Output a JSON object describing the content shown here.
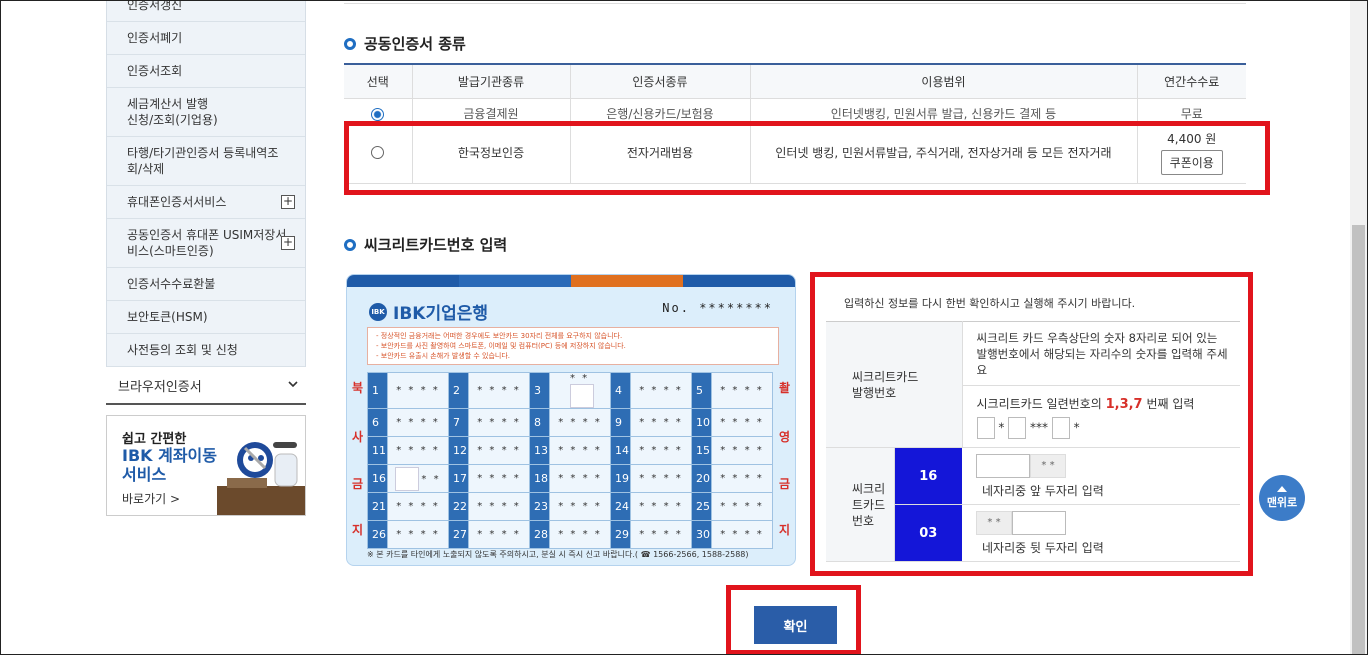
{
  "sidebar": {
    "items": [
      {
        "label": "인증서갱신"
      },
      {
        "label": "인증서폐기"
      },
      {
        "label": "인증서조회"
      },
      {
        "label": "세금계산서 발행\n신청/조회(기업용)"
      },
      {
        "label": "타행/타기관인증서 등록내역조\n회/삭제"
      },
      {
        "label": "휴대폰인증서서비스",
        "expand": "+"
      },
      {
        "label": "공동인증서 휴대폰 USIM저장서\n비스(스마트인증)",
        "expand": "+"
      },
      {
        "label": "인증서수수료환불"
      },
      {
        "label": "보안토큰(HSM)"
      },
      {
        "label": "사전등의 조회 및 신청"
      }
    ],
    "group_label": "브라우저인증서",
    "banner": {
      "line1": "쉽고 간편한",
      "line2": "IBK 계좌이동\n서비스",
      "link": "바로가기 >"
    }
  },
  "cert_section": {
    "title": "공동인증서 종류",
    "headers": [
      "선택",
      "발급기관종류",
      "인증서종류",
      "이용범위",
      "연간수수료"
    ],
    "rows": [
      {
        "org": "금융결제원",
        "type": "은행/신용카드/보험용",
        "scope": "인터넷뱅킹, 민원서류 발급, 신용카드 결제 등",
        "fee": "무료",
        "selected": true
      },
      {
        "org": "한국정보인증",
        "type": "전자거래범용",
        "scope": "인터넷 뱅킹, 민원서류발급, 주식거래, 전자상거래 등 모든 전자거래",
        "fee": "4,400 원",
        "coupon": "쿠폰이용",
        "selected": false
      }
    ]
  },
  "secret_section": {
    "title": "씨크리트카드번호 입력"
  },
  "card": {
    "bank": "IBK기업은행",
    "logo_mark": "IBK",
    "no_label": "No.",
    "no_value": "********",
    "notice": [
      "- 정상적인 금융거래는 어떠한 경우에도 보안카드 30자리 전체를 요구하지 않습니다.",
      "- 보안카드를 사진 촬영하여 스마트폰, 이메일 및 컴퓨터(PC) 등에 저장하지 않습니다.",
      "- 보안카드 유출시 손해가 발생할 수 있습니다."
    ],
    "left_chars": [
      "북",
      "사",
      "금",
      "지"
    ],
    "right_chars": [
      "촬",
      "영",
      "금",
      "지"
    ],
    "mask": "* * * *",
    "partial_mask_3": "* *",
    "partial_mask_16": "* *",
    "footer": "※ 본 카드를 타인에게 노출되지 않도록 주의하시고, 분실 시 즉시 신고 바랍니다.( ☎ 1566-2566, 1588-2588)",
    "stripe_colors": [
      "#1f5ba8",
      "#2a6ab8",
      "#e0701f",
      "#1f5ba8"
    ]
  },
  "panel": {
    "intro": "입력하신 정보를 다시 한번 확인하시고 실행해 주시기 바랍니다.",
    "issue_label": "씨크리트카드\n발행번호",
    "issue_desc": "씨크리트 카드 우측상단의 숫자 8자리로 되어 있는 발행번호에서 해당되는 자리수의 숫자를 입력해 주세요",
    "issue_prompt_pre": "시크리트카드 일련번호의",
    "issue_prompt_digits": "1,3,7",
    "issue_prompt_post": "번째 입력",
    "issue_mask": [
      "*",
      "***",
      "*"
    ],
    "card_no_label": "씨크리트카드 번호",
    "first_code": "16",
    "first_hint": "네자리중 앞 두자리 입력",
    "first_mask": "* *",
    "second_code": "03",
    "second_hint": "네자리중 뒷 두자리 입력",
    "second_mask": "* *"
  },
  "confirm_label": "확인",
  "to_top_label": "맨위로",
  "accent": "#e1141c"
}
